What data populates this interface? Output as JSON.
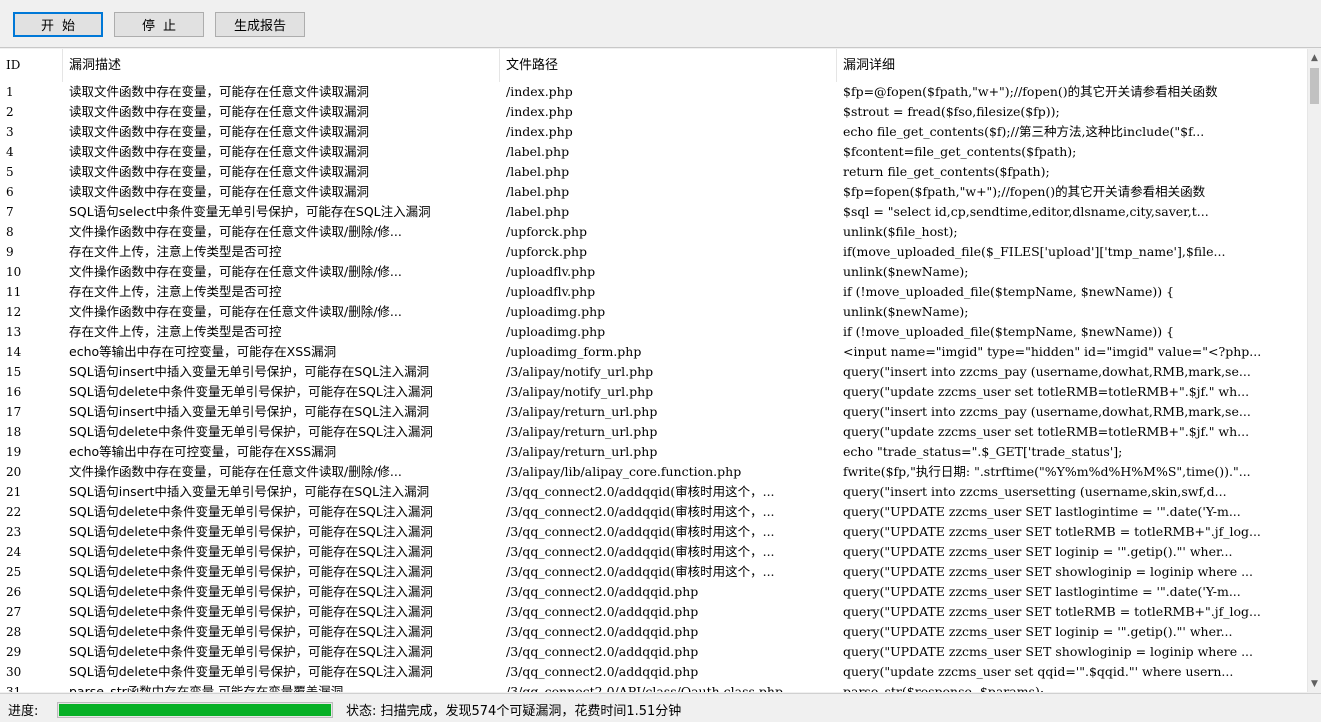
{
  "toolbar": {
    "start_label": "开始",
    "stop_label": "停止",
    "report_label": "生成报告"
  },
  "table": {
    "headers": [
      "ID",
      "漏洞描述",
      "文件路径",
      "漏洞详细"
    ],
    "rows": [
      [
        "1",
        "读取文件函数中存在变量，可能存在任意文件读取漏洞",
        "/index.php",
        "$fp=@fopen($fpath,\"w+\");//fopen()的其它开关请参看相关函数"
      ],
      [
        "2",
        "读取文件函数中存在变量，可能存在任意文件读取漏洞",
        "/index.php",
        "$strout = fread($fso,filesize($fp));"
      ],
      [
        "3",
        "读取文件函数中存在变量，可能存在任意文件读取漏洞",
        "/index.php",
        "echo file_get_contents($f);//第三种方法,这种比include(\"$f..."
      ],
      [
        "4",
        "读取文件函数中存在变量，可能存在任意文件读取漏洞",
        "/label.php",
        "$fcontent=file_get_contents($fpath);"
      ],
      [
        "5",
        "读取文件函数中存在变量，可能存在任意文件读取漏洞",
        "/label.php",
        "return file_get_contents($fpath);"
      ],
      [
        "6",
        "读取文件函数中存在变量，可能存在任意文件读取漏洞",
        "/label.php",
        "$fp=fopen($fpath,\"w+\");//fopen()的其它开关请参看相关函数"
      ],
      [
        "7",
        "SQL语句select中条件变量无单引号保护，可能存在SQL注入漏洞",
        "/label.php",
        "$sql = \"select id,cp,sendtime,editor,dlsname,city,saver,t..."
      ],
      [
        "8",
        "文件操作函数中存在变量，可能存在任意文件读取/删除/修...",
        "/upforck.php",
        "unlink($file_host);"
      ],
      [
        "9",
        "存在文件上传，注意上传类型是否可控",
        "/upforck.php",
        "if(move_uploaded_file($_FILES['upload']['tmp_name'],$file..."
      ],
      [
        "10",
        "文件操作函数中存在变量，可能存在任意文件读取/删除/修...",
        "/uploadflv.php",
        "unlink($newName);"
      ],
      [
        "11",
        "存在文件上传，注意上传类型是否可控",
        "/uploadflv.php",
        "if (!move_uploaded_file($tempName, $newName)) {"
      ],
      [
        "12",
        "文件操作函数中存在变量，可能存在任意文件读取/删除/修...",
        "/uploadimg.php",
        "unlink($newName);"
      ],
      [
        "13",
        "存在文件上传，注意上传类型是否可控",
        "/uploadimg.php",
        "if (!move_uploaded_file($tempName, $newName)) {"
      ],
      [
        "14",
        "echo等输出中存在可控变量，可能存在XSS漏洞",
        "/uploadimg_form.php",
        "<input name=\"imgid\" type=\"hidden\" id=\"imgid\" value=\"<?php..."
      ],
      [
        "15",
        "SQL语句insert中插入变量无单引号保护，可能存在SQL注入漏洞",
        "/3/alipay/notify_url.php",
        "query(\"insert into zzcms_pay (username,dowhat,RMB,mark,se..."
      ],
      [
        "16",
        "SQL语句delete中条件变量无单引号保护，可能存在SQL注入漏洞",
        "/3/alipay/notify_url.php",
        "query(\"update zzcms_user set totleRMB=totleRMB+\".$jf.\" wh..."
      ],
      [
        "17",
        "SQL语句insert中插入变量无单引号保护，可能存在SQL注入漏洞",
        "/3/alipay/return_url.php",
        "query(\"insert into zzcms_pay (username,dowhat,RMB,mark,se..."
      ],
      [
        "18",
        "SQL语句delete中条件变量无单引号保护，可能存在SQL注入漏洞",
        "/3/alipay/return_url.php",
        "query(\"update zzcms_user set totleRMB=totleRMB+\".$jf.\" wh..."
      ],
      [
        "19",
        "echo等输出中存在可控变量，可能存在XSS漏洞",
        "/3/alipay/return_url.php",
        "echo \"trade_status=\".$_GET['trade_status'];"
      ],
      [
        "20",
        "文件操作函数中存在变量，可能存在任意文件读取/删除/修...",
        "/3/alipay/lib/alipay_core.function.php",
        "fwrite($fp,\"执行日期: \".strftime(\"%Y%m%d%H%M%S\",time()).\"..."
      ],
      [
        "21",
        "SQL语句insert中插入变量无单引号保护，可能存在SQL注入漏洞",
        "/3/qq_connect2.0/addqqid(审核时用这个，...",
        "query(\"insert into zzcms_usersetting (username,skin,swf,d..."
      ],
      [
        "22",
        "SQL语句delete中条件变量无单引号保护，可能存在SQL注入漏洞",
        "/3/qq_connect2.0/addqqid(审核时用这个，...",
        "query(\"UPDATE zzcms_user SET lastlogintime = '\".date('Y-m..."
      ],
      [
        "23",
        "SQL语句delete中条件变量无单引号保护，可能存在SQL注入漏洞",
        "/3/qq_connect2.0/addqqid(审核时用这个，...",
        "query(\"UPDATE zzcms_user SET totleRMB = totleRMB+\".jf_log..."
      ],
      [
        "24",
        "SQL语句delete中条件变量无单引号保护，可能存在SQL注入漏洞",
        "/3/qq_connect2.0/addqqid(审核时用这个，...",
        "query(\"UPDATE zzcms_user SET loginip = '\".getip().\"' wher..."
      ],
      [
        "25",
        "SQL语句delete中条件变量无单引号保护，可能存在SQL注入漏洞",
        "/3/qq_connect2.0/addqqid(审核时用这个，...",
        "query(\"UPDATE zzcms_user SET showloginip = loginip where ..."
      ],
      [
        "26",
        "SQL语句delete中条件变量无单引号保护，可能存在SQL注入漏洞",
        "/3/qq_connect2.0/addqqid.php",
        "query(\"UPDATE zzcms_user SET lastlogintime = '\".date('Y-m..."
      ],
      [
        "27",
        "SQL语句delete中条件变量无单引号保护，可能存在SQL注入漏洞",
        "/3/qq_connect2.0/addqqid.php",
        "query(\"UPDATE zzcms_user SET totleRMB = totleRMB+\".jf_log..."
      ],
      [
        "28",
        "SQL语句delete中条件变量无单引号保护，可能存在SQL注入漏洞",
        "/3/qq_connect2.0/addqqid.php",
        "query(\"UPDATE zzcms_user SET loginip = '\".getip().\"' wher..."
      ],
      [
        "29",
        "SQL语句delete中条件变量无单引号保护，可能存在SQL注入漏洞",
        "/3/qq_connect2.0/addqqid.php",
        "query(\"UPDATE zzcms_user SET showloginip = loginip where ..."
      ],
      [
        "30",
        "SQL语句delete中条件变量无单引号保护，可能存在SQL注入漏洞",
        "/3/qq_connect2.0/addqqid.php",
        "query(\"update zzcms_user set qqid='\".$qqid.\"' where usern..."
      ],
      [
        "31",
        "parse_str函数中存在变量,可能存在变量覆盖漏洞",
        "/3/qq_connect2.0/API/class/Oauth.class.php",
        "parse_str($response, $params);"
      ]
    ]
  },
  "statusbar": {
    "progress_label": "进度:",
    "progress": 1.0,
    "status_text": "状态: 扫描完成，发现574个可疑漏洞，花费时间1.51分钟"
  }
}
